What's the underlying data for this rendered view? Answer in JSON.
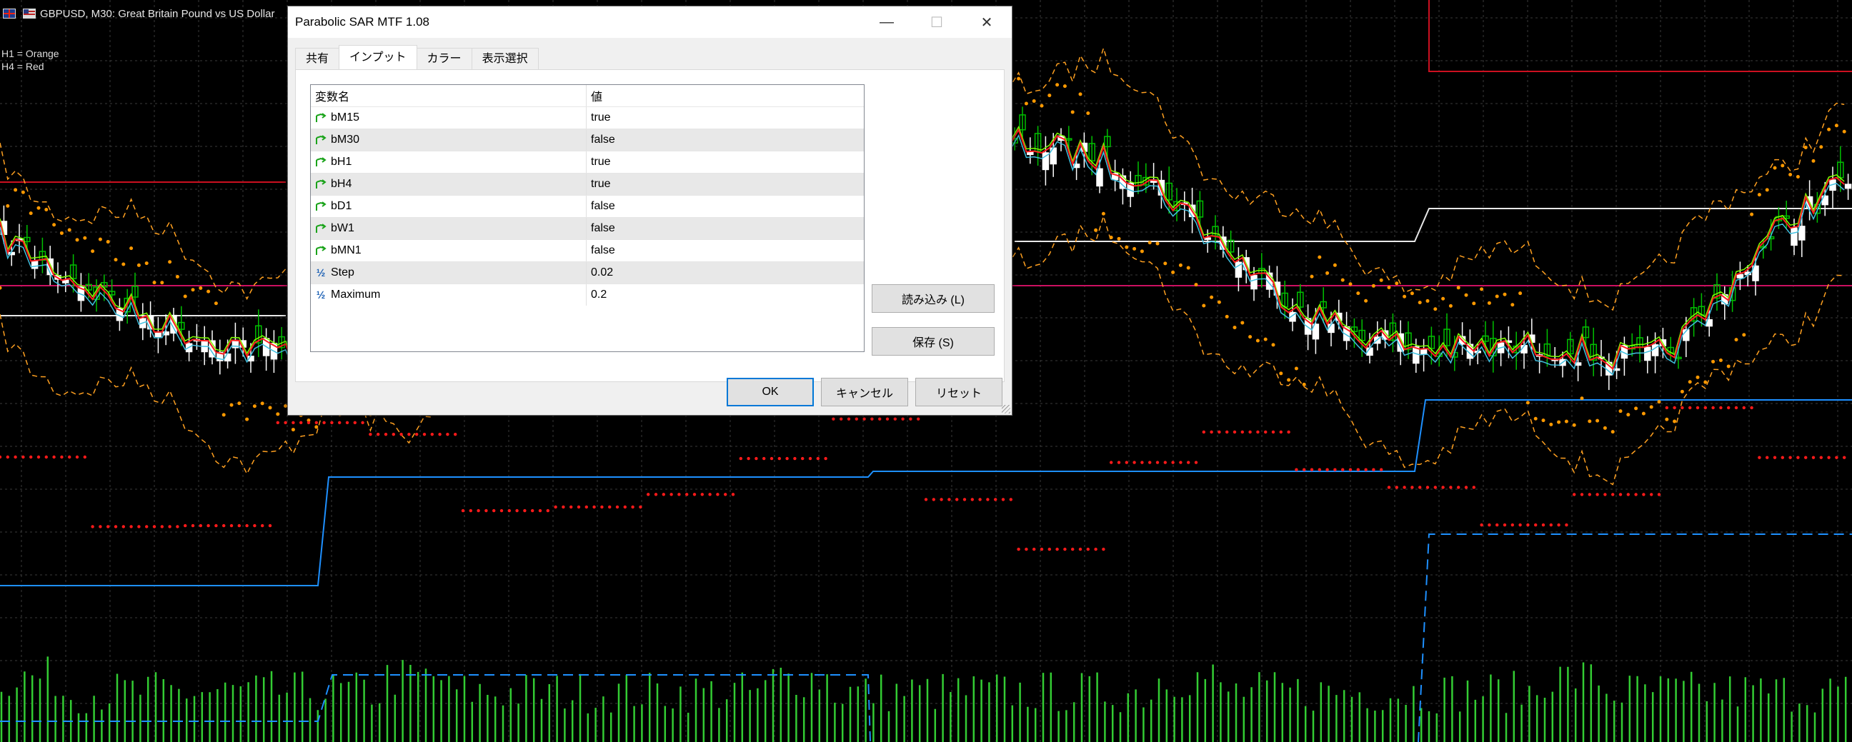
{
  "chart_header": {
    "symbol_text": "GBPUSD, M30:  Great Britain Pound vs US Dollar"
  },
  "legend": [
    "H1 = Orange",
    "H4 = Red"
  ],
  "dialog": {
    "title": "Parabolic SAR MTF 1.08",
    "window_buttons": {
      "minimize": "—",
      "maximize": "☐",
      "close": "✕"
    },
    "tabs": [
      "共有",
      "インプット",
      "カラー",
      "表示選択"
    ],
    "active_tab": "インプット",
    "grid": {
      "header": {
        "name": "変数名",
        "value": "値"
      },
      "rows": [
        {
          "icon": "arrow-icon",
          "name": "bM15",
          "value": "true"
        },
        {
          "icon": "arrow-icon",
          "name": "bM30",
          "value": "false"
        },
        {
          "icon": "arrow-icon",
          "name": "bH1",
          "value": "true"
        },
        {
          "icon": "arrow-icon",
          "name": "bH4",
          "value": "true"
        },
        {
          "icon": "arrow-icon",
          "name": "bD1",
          "value": "false"
        },
        {
          "icon": "arrow-icon",
          "name": "bW1",
          "value": "false"
        },
        {
          "icon": "arrow-icon",
          "name": "bMN1",
          "value": "false"
        },
        {
          "icon": "half-icon",
          "name": "Step",
          "value": "0.02"
        },
        {
          "icon": "half-icon",
          "name": "Maximum",
          "value": "0.2"
        }
      ]
    },
    "load_button": "読み込み (L)",
    "save_button": "保存 (S)",
    "ok_button": "OK",
    "cancel_button": "キャンセル",
    "reset_button": "リセット"
  },
  "colors": {
    "chart_bg": "#000000",
    "grid": "#3a3a3a",
    "bull_candle": "#00c000",
    "bear_candle": "#ffffff",
    "sar_orange": "#ff9900",
    "sar_red": "#ff1a1a",
    "ma_red": "#ff2020",
    "ma_green": "#7fff00",
    "ma_cyan": "#40c0e0",
    "band_orange": "#ffa020",
    "line_blue": "#1e90ff",
    "volume": "#33cc33",
    "accent": "#0078d7"
  }
}
